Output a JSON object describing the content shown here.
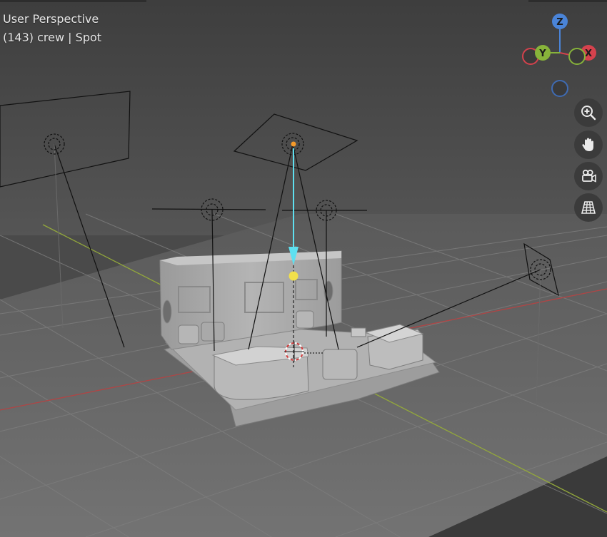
{
  "viewport": {
    "mode": "User Perspective",
    "frame": "(143)",
    "collection": "crew",
    "active_object": "Spot",
    "separator": "|"
  },
  "gizmo": {
    "axis_z": "Z",
    "axis_y": "Y",
    "axis_x": "X",
    "colors": {
      "z": "#4a84d8",
      "y": "#87b33a",
      "x": "#d5424d",
      "neg_z": "#3f6bb3"
    }
  },
  "navigation": [
    {
      "name": "zoom-button",
      "icon": "zoom-in-icon"
    },
    {
      "name": "pan-button",
      "icon": "hand-icon"
    },
    {
      "name": "camera-view-button",
      "icon": "camera-icon"
    },
    {
      "name": "ortho-toggle-button",
      "icon": "grid-icon"
    }
  ],
  "colors": {
    "background_top": "#3f3f3f",
    "floor": "#6b6b6b",
    "x_axis_line": "#b04545",
    "y_axis_line": "#93a83b",
    "light_direction": "#5ee0f0",
    "light_target": "#f2e04a",
    "active_origin": "#f59a2a"
  }
}
